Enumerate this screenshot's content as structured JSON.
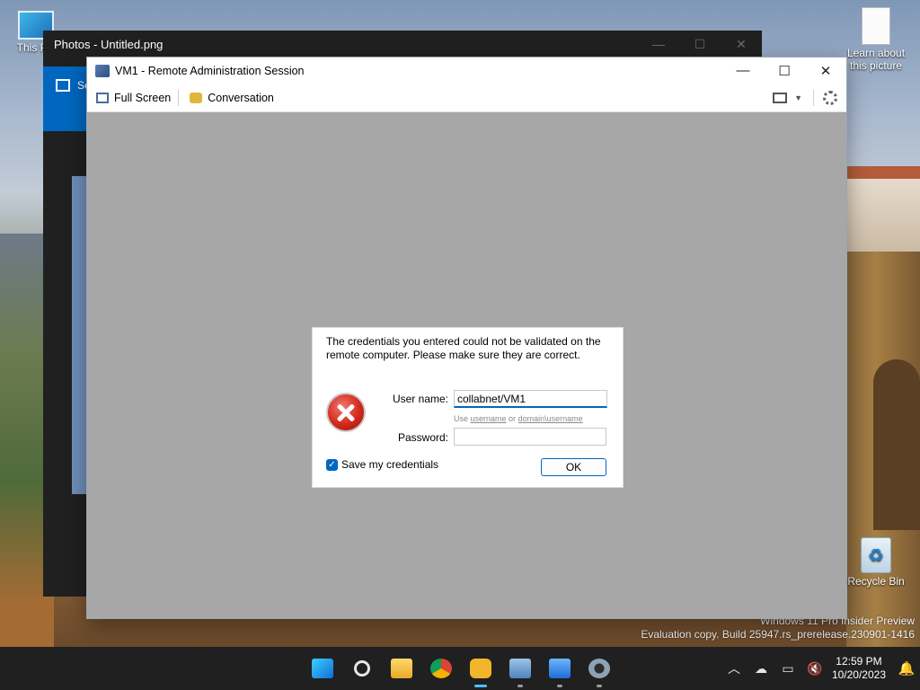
{
  "desktop": {
    "icons": [
      {
        "label": "This PC"
      },
      {
        "label": "Learn about this picture"
      },
      {
        "label": "Recycle Bin"
      }
    ],
    "watermark": {
      "line1": "Windows 11 Pro Insider Preview",
      "line2": "Evaluation copy. Build 25947.rs_prerelease.230901-1416"
    }
  },
  "photos_window": {
    "title": "Photos - Untitled.png",
    "sidebar_label": "Se",
    "controls": {
      "minimize": "—",
      "maximize": "☐",
      "close": "✕"
    }
  },
  "rdp_window": {
    "title": "VM1 - Remote Administration Session",
    "controls": {
      "minimize": "—",
      "maximize": "☐",
      "close": "✕"
    },
    "toolbar": {
      "full_screen": "Full Screen",
      "conversation": "Conversation",
      "dropdown_caret": "▼"
    }
  },
  "dialog": {
    "message": "The credentials you entered could not be validated on the remote computer. Please make sure they are correct.",
    "username_label": "User name:",
    "username_value": "collabnet/VM1",
    "hint_prefix": "Use ",
    "hint_username": "username",
    "hint_or": " or ",
    "hint_domain": "domain\\username",
    "password_label": "Password:",
    "password_value": "",
    "save_credentials_label": "Save my credentials",
    "save_credentials_checked": true,
    "ok_label": "OK"
  },
  "taskbar": {
    "apps": [
      "start",
      "search",
      "file-explorer",
      "chrome",
      "remote-session",
      "resource-monitor",
      "photos",
      "settings"
    ],
    "tray": {
      "chevron": "︿"
    },
    "clock": {
      "time": "12:59 PM",
      "date": "10/20/2023"
    }
  }
}
